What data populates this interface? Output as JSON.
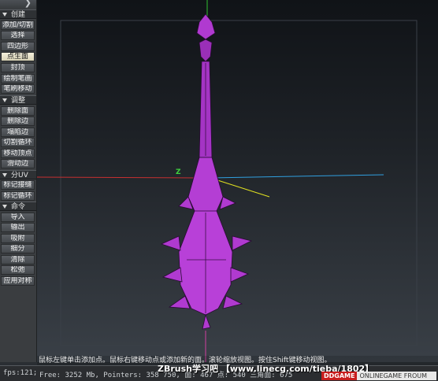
{
  "app": {
    "logo_text": "❯"
  },
  "left_panel": {
    "sections": [
      {
        "title": "创建",
        "buttons": [
          "添加/切割",
          "选择",
          "四边形",
          "点生面",
          "封顶",
          "绘制笔画",
          "笔刷移动"
        ],
        "active_index": 3
      },
      {
        "title": "调整",
        "buttons": [
          "删除面",
          "删除边",
          "塌陷边",
          "切割循环",
          "移动顶点",
          "滑动边"
        ]
      },
      {
        "title": "分UV",
        "buttons": [
          "标记接缝",
          "标记循环"
        ]
      },
      {
        "title": "命令",
        "buttons": [
          "导入",
          "输出",
          "吸附",
          "细分",
          "清除",
          "松弛",
          "应用对称"
        ]
      }
    ]
  },
  "viewport": {
    "axis_label_z": "Z",
    "colors": {
      "mesh_fill": "#b03ad0",
      "mesh_edge": "#2a0a35",
      "axis_x": "#d03030",
      "axis_y": "#30c030",
      "axis_z": "#30a0e0",
      "gizmo_yellow": "#e0e020"
    }
  },
  "hint_bar": {
    "text": "鼠标左键单击添加点。鼠标右键移动点或添加新的面。滚轮缩放视图。按住Shift键移动视图。"
  },
  "status_bar": {
    "fps": "fps:121;",
    "memory": "Free: 3252 Mb, Pointers: 358 750, 面: 467 点: 540 三角面: 675"
  },
  "watermark": {
    "text": "ZBrush学习吧 【www.linecg.com/tieba/1802】",
    "logo_brand": "DDGAME",
    "logo_sub": "ONLINEGAME FROUM"
  }
}
